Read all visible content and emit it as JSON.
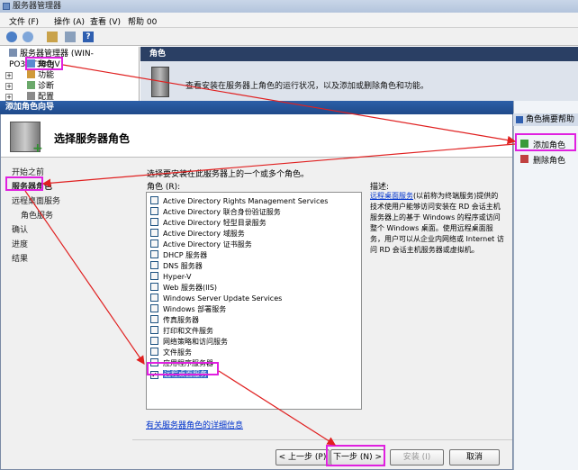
{
  "server_manager": {
    "title": "服务器管理器",
    "menu": [
      "文件 (F)",
      "操作 (A)",
      "查看 (V)",
      "帮助 00"
    ],
    "tree": {
      "root": "服务器管理器 (WIN-PO3DT380JV",
      "items": [
        "角色",
        "功能",
        "诊断",
        "配置"
      ]
    },
    "right_header": "角色",
    "right_description": "查看安装在服务器上角色的运行状况，以及添加或删除角色和功能。",
    "actions": {
      "header": "角色摘要帮助",
      "items": [
        "添加角色",
        "删除角色"
      ]
    }
  },
  "wizard": {
    "title": "添加角色向导",
    "heading": "选择服务器角色",
    "nav": [
      "开始之前",
      "服务器角色",
      "远程桌面服务",
      "角色服务",
      "确认",
      "进度",
      "结果"
    ],
    "intro": "选择要安装在此服务器上的一个或多个角色。",
    "roles_label": "角色 (R):",
    "roles": [
      {
        "label": "Active Directory Rights Management Services",
        "checked": false
      },
      {
        "label": "Active Directory 联合身份验证服务",
        "checked": false
      },
      {
        "label": "Active Directory 轻型目录服务",
        "checked": false
      },
      {
        "label": "Active Directory 域服务",
        "checked": false
      },
      {
        "label": "Active Directory 证书服务",
        "checked": false
      },
      {
        "label": "DHCP 服务器",
        "checked": false
      },
      {
        "label": "DNS 服务器",
        "checked": false
      },
      {
        "label": "Hyper-V",
        "checked": false
      },
      {
        "label": "Web 服务器(IIS)",
        "checked": false
      },
      {
        "label": "Windows Server Update Services",
        "checked": false
      },
      {
        "label": "Windows 部署服务",
        "checked": false
      },
      {
        "label": "传真服务器",
        "checked": false
      },
      {
        "label": "打印和文件服务",
        "checked": false
      },
      {
        "label": "网络策略和访问服务",
        "checked": false
      },
      {
        "label": "文件服务",
        "checked": false
      },
      {
        "label": "应用程序服务器",
        "checked": false
      },
      {
        "label": "远程桌面服务",
        "checked": true
      }
    ],
    "description_label": "描述:",
    "description_link": "远程桌面服务",
    "description_body": "(以前称为终端服务)提供的技术使用户能够访问安装在 RD 会话主机服务器上的基于 Windows 的程序或访问整个 Windows 桌面。使用远程桌面服务，用户可以从企业内网络或 Internet 访问 RD 会话主机服务器或虚拟机。",
    "more_info": "有关服务器角色的详细信息",
    "buttons": {
      "prev": "< 上一步 (P)",
      "next": "下一步 (N) >",
      "install": "安装 (I)",
      "cancel": "取消"
    }
  },
  "colors": {
    "highlight": "#e020e0",
    "arrow": "#e02020",
    "selection": "#316ac5",
    "header_bar": "#2a3f64"
  }
}
